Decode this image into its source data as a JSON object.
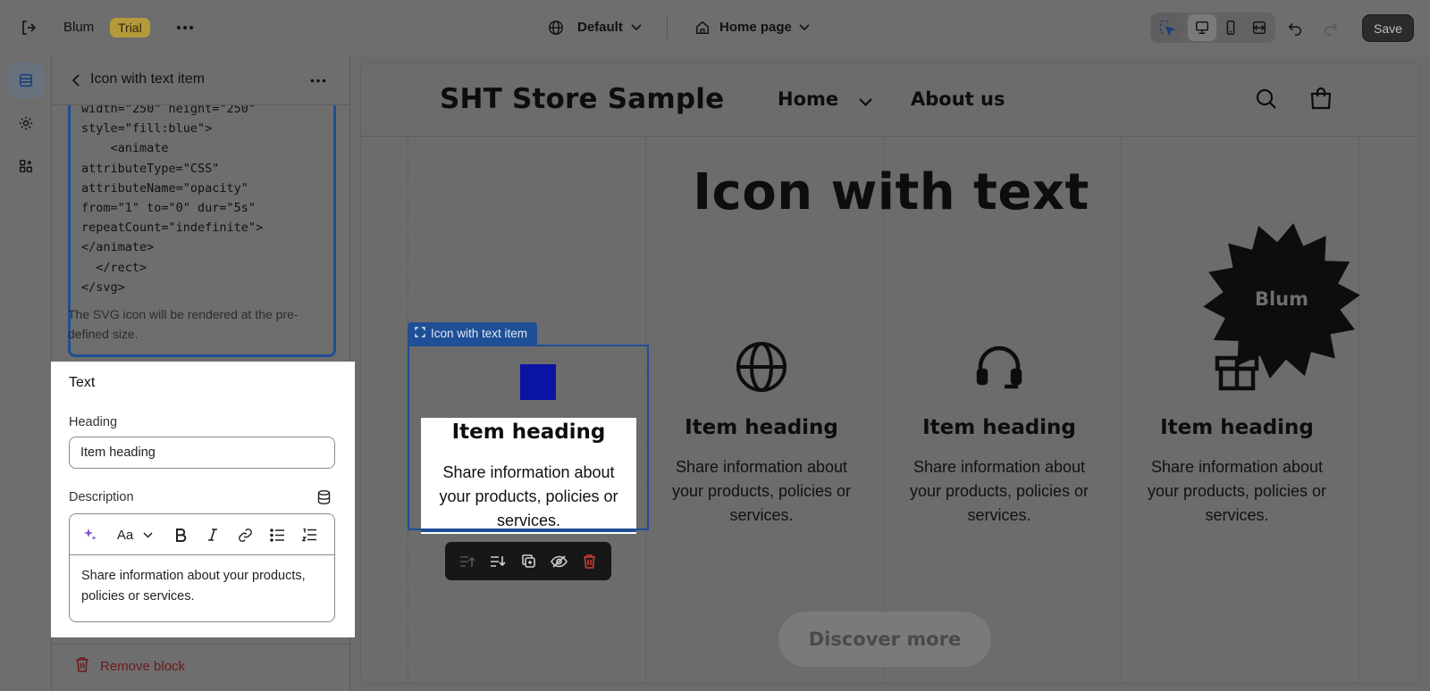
{
  "topbar": {
    "store_name": "Blum",
    "trial_badge": "Trial",
    "theme_selector": "Default",
    "page_selector": "Home page",
    "save_label": "Save"
  },
  "panel": {
    "title": "Icon with text item",
    "code_lines": [
      "width=\"250\" height=\"250\"",
      "style=\"fill:blue\">",
      "    <animate",
      "attributeType=\"CSS\"",
      "attributeName=\"opacity\"",
      "from=\"1\" to=\"0\" dur=\"5s\"",
      "repeatCount=\"indefinite\">",
      "</animate>",
      "  </rect>",
      "</svg>"
    ],
    "helper_text": "The SVG icon will be rendered at the pre-defined size.",
    "text_section": {
      "title": "Text",
      "heading_label": "Heading",
      "heading_value": "Item heading",
      "description_label": "Description",
      "text_style_label": "Aa",
      "description_value": "Share information about your products, policies or services."
    },
    "remove_label": "Remove block"
  },
  "preview": {
    "store_title": "SHT Store Sample",
    "nav": {
      "home": "Home",
      "about": "About us"
    },
    "section_title": "Icon with text",
    "selected_tag": "Icon with text item",
    "badge_text": "Blum",
    "items": [
      {
        "heading": "Item heading",
        "description": "Share information about your products, policies or services.",
        "icon": "blue-square-icon"
      },
      {
        "heading": "Item heading",
        "description": "Share information about your products, policies or services.",
        "icon": "globe-icon"
      },
      {
        "heading": "Item heading",
        "description": "Share information about your products, policies or services.",
        "icon": "headphones-icon"
      },
      {
        "heading": "Item heading",
        "description": "Share information about your products, policies or services.",
        "icon": "gift-icon"
      }
    ],
    "cta": "Discover more"
  },
  "colors": {
    "selection_blue": "#1f4f96",
    "icon_blue": "#0b13a4",
    "trial_badge": "#b59a3c",
    "danger": "#d13b3b"
  }
}
